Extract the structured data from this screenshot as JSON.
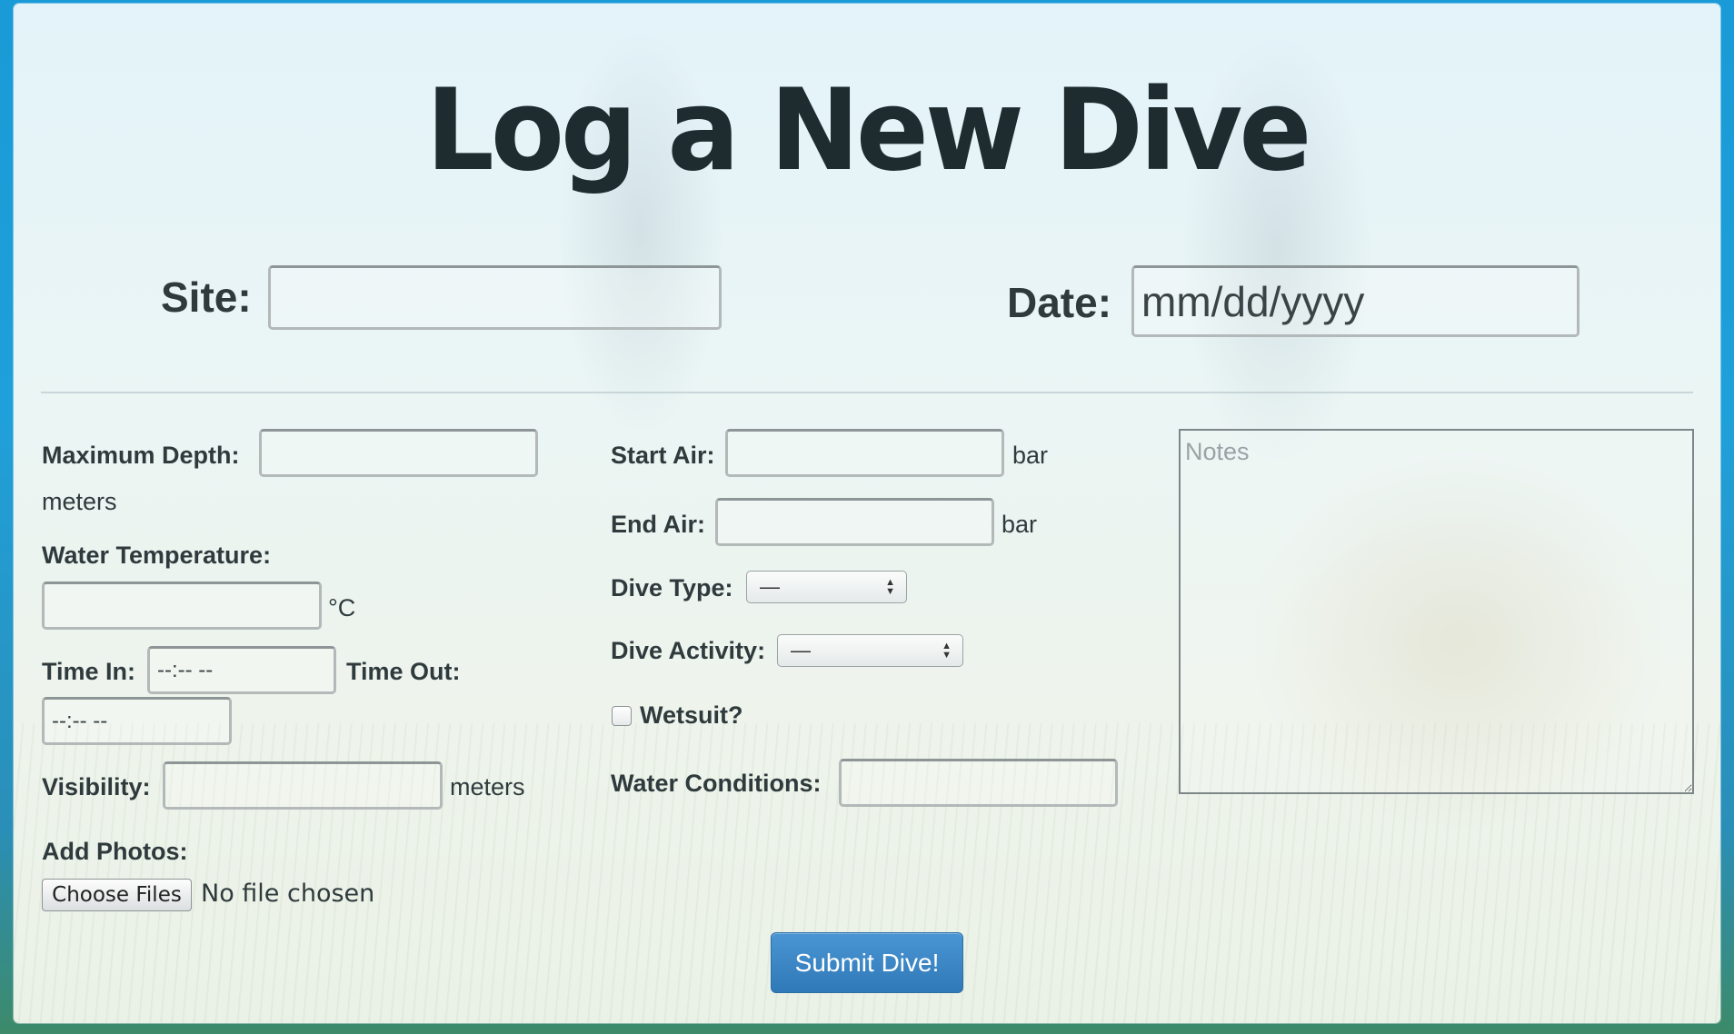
{
  "page": {
    "title": "Log a New Dive"
  },
  "top": {
    "site_label": "Site:",
    "site_value": "",
    "date_label": "Date:",
    "date_value": "mm/dd/yyyy"
  },
  "col1": {
    "max_depth_label": "Maximum Depth:",
    "max_depth_value": "",
    "max_depth_unit": "meters",
    "water_temp_label": "Water Temperature:",
    "water_temp_value": "",
    "water_temp_unit": "°C",
    "time_in_label": "Time In:",
    "time_in_value": "--:-- --",
    "time_out_label": "Time Out:",
    "time_out_value": "--:-- --",
    "visibility_label": "Visibility:",
    "visibility_value": "",
    "visibility_unit": "meters",
    "photos_label": "Add Photos:",
    "choose_files_label": "Choose Files",
    "no_file_text": "No file chosen"
  },
  "col2": {
    "start_air_label": "Start Air:",
    "start_air_value": "",
    "start_air_unit": "bar",
    "end_air_label": "End Air:",
    "end_air_value": "",
    "end_air_unit": "bar",
    "dive_type_label": "Dive Type:",
    "dive_type_selected": "—",
    "dive_activity_label": "Dive Activity:",
    "dive_activity_selected": "—",
    "wetsuit_label": "Wetsuit?",
    "wetsuit_checked": false,
    "water_conditions_label": "Water Conditions:",
    "water_conditions_value": ""
  },
  "notes": {
    "placeholder": "Notes",
    "value": ""
  },
  "submit_label": "Submit Dive!",
  "colors": {
    "submit_bg": "#3a86c6",
    "title_text": "#1e2c30",
    "label_text": "#2f3a3d"
  }
}
